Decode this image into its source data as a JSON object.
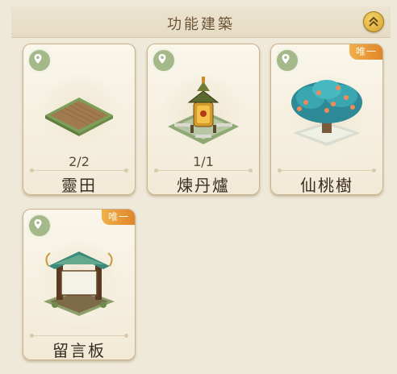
{
  "header": {
    "title": "功能建築",
    "collapse_icon": "double-chevron-up-icon"
  },
  "buildings": [
    {
      "id": "spirit-field",
      "name": "靈田",
      "count": "2/2",
      "unique_badge": ""
    },
    {
      "id": "alchemy-furnace",
      "name": "煉丹爐",
      "count": "1/1",
      "unique_badge": ""
    },
    {
      "id": "peach-tree",
      "name": "仙桃樹",
      "count": "",
      "unique_badge": "唯一"
    },
    {
      "id": "message-board",
      "name": "留言板",
      "count": "",
      "unique_badge": "唯一"
    }
  ],
  "icons": {
    "location": "location-pin-icon"
  },
  "colors": {
    "badge": "#e89a3a",
    "pin_bg": "#a5b88a",
    "title": "#6b5538"
  }
}
